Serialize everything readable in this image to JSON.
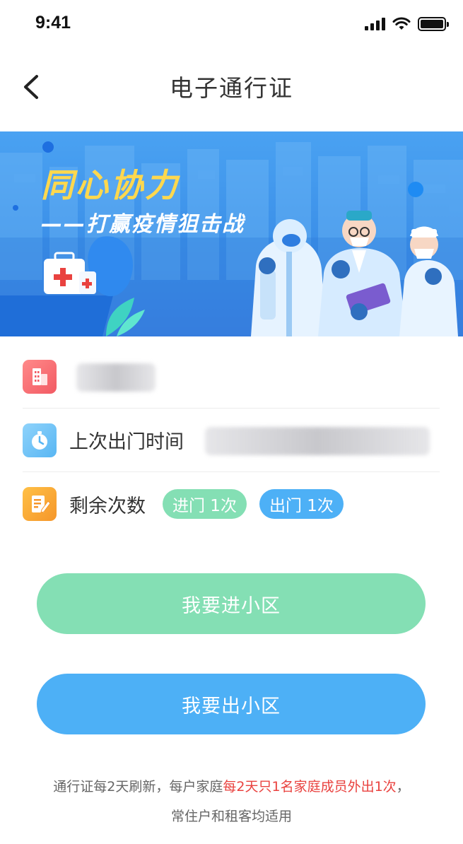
{
  "status_bar": {
    "time": "9:41"
  },
  "nav": {
    "title": "电子通行证"
  },
  "banner": {
    "headline": "同心协力",
    "subline": "——打赢疫情狙击战"
  },
  "info": {
    "community": {
      "visible_char": ""
    },
    "last_exit": {
      "label": "上次出门时间"
    },
    "remaining": {
      "label": "剩余次数",
      "enter_badge": "进门 1次",
      "exit_badge": "出门 1次"
    }
  },
  "actions": {
    "enter_label": "我要进小区",
    "exit_label": "我要出小区"
  },
  "note": {
    "prefix": "通行证每2天刷新，每户家庭",
    "highlight": "每2天只1名家庭成员外出1次",
    "suffix": "，",
    "line2": "常住户和租客均适用"
  },
  "colors": {
    "accent_green": "#84dfb4",
    "accent_blue": "#4db0f6",
    "highlight_red": "#e9423f",
    "banner_blue": "#3b8fe8"
  },
  "icons": {
    "back": "chevron-left-icon",
    "community": "building-icon",
    "last_exit": "stopwatch-icon",
    "remaining": "note-edit-icon"
  }
}
